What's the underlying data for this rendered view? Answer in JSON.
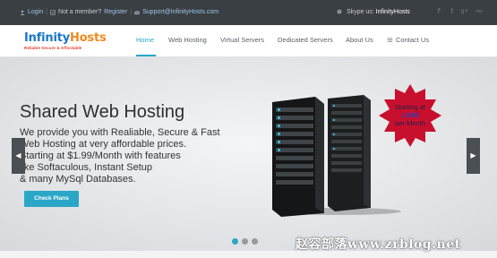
{
  "topbar": {
    "login": "Login",
    "not_member": "Not a member?",
    "register": "Register",
    "support_email": "Support@InfinityHosts.com",
    "skype_label": "Skype us:",
    "skype_name": "InfinityHosts",
    "social": [
      "f",
      "t",
      "g+",
      "rss"
    ]
  },
  "logo": {
    "word_part1": "Infinity",
    "word_part2": "Hosts",
    "tagline": "Reliable Secure & Affordable"
  },
  "nav": {
    "items": [
      {
        "label": "Home",
        "active": true
      },
      {
        "label": "Web Hosting",
        "active": false
      },
      {
        "label": "Virtual Servers",
        "active": false
      },
      {
        "label": "Dedicated Servers",
        "active": false
      },
      {
        "label": "About Us",
        "active": false
      },
      {
        "label": "Contact Us",
        "active": false
      }
    ]
  },
  "hero": {
    "title": "Shared Web Hosting",
    "lines": [
      "We provide you with Realiable, Secure & Fast",
      "Web Hosting at very affordable prices.",
      "Starting at $1.99/Month with features",
      "like Softaculous, Instant Setup",
      "& many MySql Databases."
    ],
    "button": "Check Plans",
    "badge": {
      "line1": "Starting at",
      "price": "1.99$",
      "line3": "per Month"
    },
    "slides": 3,
    "active_slide": 0
  },
  "watermark": "赵容部落www.zrblog.net",
  "colors": {
    "accent": "#2aa7c7",
    "topbar": "#3a3f44",
    "badge": "#c8102e"
  }
}
